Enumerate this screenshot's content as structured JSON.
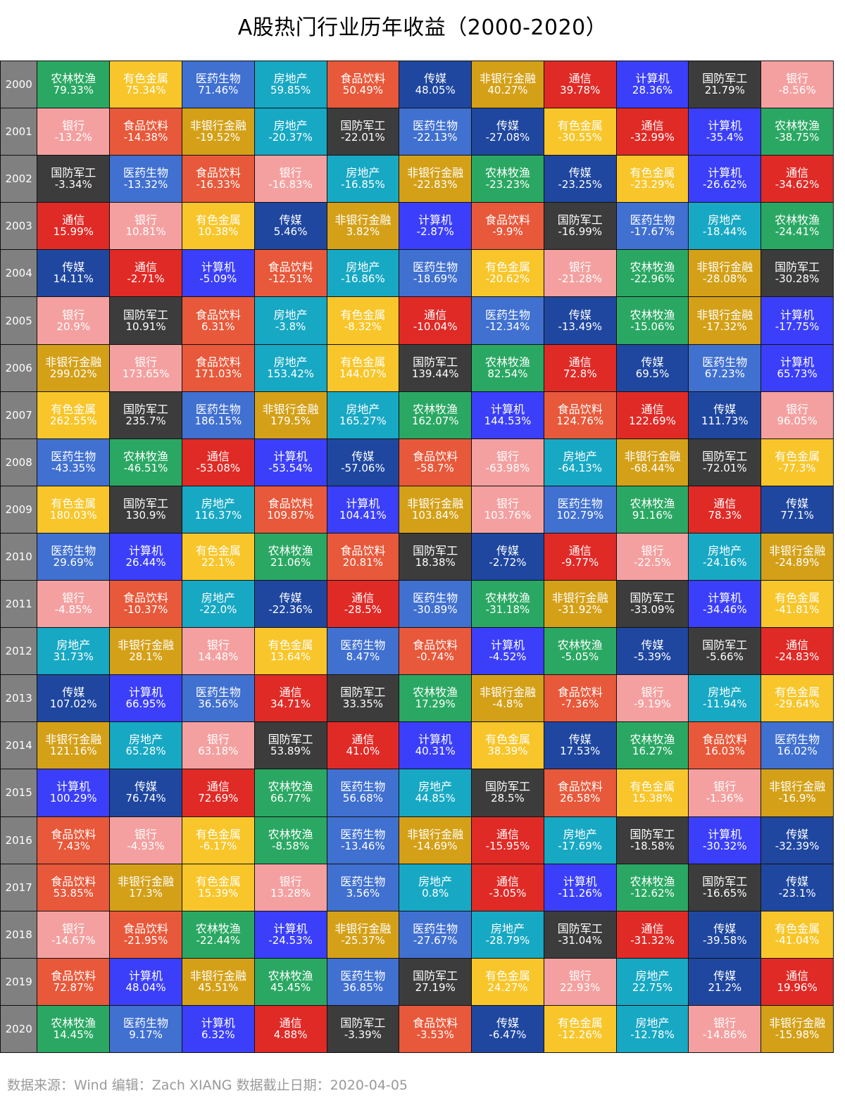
{
  "title": "A股热门行业历年收益（2000-2020）",
  "footer": "数据来源：Wind 编辑：Zach XIANG 数据截止日期：2020-04-05",
  "colors": {
    "农林牧渔": "#2aa863",
    "有色金属": "#f8c62a",
    "医药生物": "#4070d0",
    "房地产": "#17a8c4",
    "食品饮料": "#e8583a",
    "传媒": "#1f47a0",
    "非银行金融": "#d4a017",
    "通信": "#e02a26",
    "计算机": "#3b3ffa",
    "国防军工": "#3c3c3c",
    "银行": "#f4a0a0"
  },
  "chart_data": {
    "type": "table",
    "title": "A股热门行业历年收益（2000-2020）",
    "rows": [
      {
        "year": "2000",
        "cells": [
          [
            "农林牧渔",
            "79.33%"
          ],
          [
            "有色金属",
            "75.34%"
          ],
          [
            "医药生物",
            "71.46%"
          ],
          [
            "房地产",
            "59.85%"
          ],
          [
            "食品饮料",
            "50.49%"
          ],
          [
            "传媒",
            "48.05%"
          ],
          [
            "非银行金融",
            "40.27%"
          ],
          [
            "通信",
            "39.78%"
          ],
          [
            "计算机",
            "28.36%"
          ],
          [
            "国防军工",
            "21.79%"
          ],
          [
            "银行",
            "-8.56%"
          ]
        ]
      },
      {
        "year": "2001",
        "cells": [
          [
            "银行",
            "-13.2%"
          ],
          [
            "食品饮料",
            "-14.38%"
          ],
          [
            "非银行金融",
            "-19.52%"
          ],
          [
            "房地产",
            "-20.37%"
          ],
          [
            "国防军工",
            "-22.01%"
          ],
          [
            "医药生物",
            "-22.13%"
          ],
          [
            "传媒",
            "-27.08%"
          ],
          [
            "有色金属",
            "-30.55%"
          ],
          [
            "通信",
            "-32.99%"
          ],
          [
            "计算机",
            "-35.4%"
          ],
          [
            "农林牧渔",
            "-38.75%"
          ]
        ]
      },
      {
        "year": "2002",
        "cells": [
          [
            "国防军工",
            "-3.34%"
          ],
          [
            "医药生物",
            "-13.32%"
          ],
          [
            "食品饮料",
            "-16.33%"
          ],
          [
            "银行",
            "-16.83%"
          ],
          [
            "房地产",
            "-16.85%"
          ],
          [
            "非银行金融",
            "-22.83%"
          ],
          [
            "农林牧渔",
            "-23.23%"
          ],
          [
            "传媒",
            "-23.25%"
          ],
          [
            "有色金属",
            "-23.29%"
          ],
          [
            "计算机",
            "-26.62%"
          ],
          [
            "通信",
            "-34.62%"
          ]
        ]
      },
      {
        "year": "2003",
        "cells": [
          [
            "通信",
            "15.99%"
          ],
          [
            "银行",
            "10.81%"
          ],
          [
            "有色金属",
            "10.38%"
          ],
          [
            "传媒",
            "5.46%"
          ],
          [
            "非银行金融",
            "3.82%"
          ],
          [
            "计算机",
            "-2.87%"
          ],
          [
            "食品饮料",
            "-9.9%"
          ],
          [
            "国防军工",
            "-16.99%"
          ],
          [
            "医药生物",
            "-17.67%"
          ],
          [
            "房地产",
            "-18.44%"
          ],
          [
            "农林牧渔",
            "-24.41%"
          ]
        ]
      },
      {
        "year": "2004",
        "cells": [
          [
            "传媒",
            "14.11%"
          ],
          [
            "通信",
            "-2.71%"
          ],
          [
            "计算机",
            "-5.09%"
          ],
          [
            "食品饮料",
            "-12.51%"
          ],
          [
            "房地产",
            "-16.86%"
          ],
          [
            "医药生物",
            "-18.69%"
          ],
          [
            "有色金属",
            "-20.62%"
          ],
          [
            "银行",
            "-21.28%"
          ],
          [
            "农林牧渔",
            "-22.96%"
          ],
          [
            "非银行金融",
            "-28.08%"
          ],
          [
            "国防军工",
            "-30.28%"
          ]
        ]
      },
      {
        "year": "2005",
        "cells": [
          [
            "银行",
            "20.9%"
          ],
          [
            "国防军工",
            "10.91%"
          ],
          [
            "食品饮料",
            "6.31%"
          ],
          [
            "房地产",
            "-3.8%"
          ],
          [
            "有色金属",
            "-8.32%"
          ],
          [
            "通信",
            "-10.04%"
          ],
          [
            "医药生物",
            "-12.34%"
          ],
          [
            "传媒",
            "-13.49%"
          ],
          [
            "农林牧渔",
            "-15.06%"
          ],
          [
            "非银行金融",
            "-17.32%"
          ],
          [
            "计算机",
            "-17.75%"
          ]
        ]
      },
      {
        "year": "2006",
        "cells": [
          [
            "非银行金融",
            "299.02%"
          ],
          [
            "银行",
            "173.65%"
          ],
          [
            "食品饮料",
            "171.03%"
          ],
          [
            "房地产",
            "153.42%"
          ],
          [
            "有色金属",
            "144.07%"
          ],
          [
            "国防军工",
            "139.44%"
          ],
          [
            "农林牧渔",
            "82.54%"
          ],
          [
            "通信",
            "72.8%"
          ],
          [
            "传媒",
            "69.5%"
          ],
          [
            "医药生物",
            "67.23%"
          ],
          [
            "计算机",
            "65.73%"
          ]
        ]
      },
      {
        "year": "2007",
        "cells": [
          [
            "有色金属",
            "262.55%"
          ],
          [
            "国防军工",
            "235.7%"
          ],
          [
            "医药生物",
            "186.15%"
          ],
          [
            "非银行金融",
            "179.5%"
          ],
          [
            "房地产",
            "165.27%"
          ],
          [
            "农林牧渔",
            "162.07%"
          ],
          [
            "计算机",
            "144.53%"
          ],
          [
            "食品饮料",
            "124.76%"
          ],
          [
            "通信",
            "122.69%"
          ],
          [
            "传媒",
            "111.73%"
          ],
          [
            "银行",
            "96.05%"
          ]
        ]
      },
      {
        "year": "2008",
        "cells": [
          [
            "医药生物",
            "-43.35%"
          ],
          [
            "农林牧渔",
            "-46.51%"
          ],
          [
            "通信",
            "-53.08%"
          ],
          [
            "计算机",
            "-53.54%"
          ],
          [
            "传媒",
            "-57.06%"
          ],
          [
            "食品饮料",
            "-58.7%"
          ],
          [
            "银行",
            "-63.98%"
          ],
          [
            "房地产",
            "-64.13%"
          ],
          [
            "非银行金融",
            "-68.44%"
          ],
          [
            "国防军工",
            "-72.01%"
          ],
          [
            "有色金属",
            "-77.3%"
          ]
        ]
      },
      {
        "year": "2009",
        "cells": [
          [
            "有色金属",
            "180.03%"
          ],
          [
            "国防军工",
            "130.9%"
          ],
          [
            "房地产",
            "116.37%"
          ],
          [
            "食品饮料",
            "109.87%"
          ],
          [
            "计算机",
            "104.41%"
          ],
          [
            "非银行金融",
            "103.84%"
          ],
          [
            "银行",
            "103.76%"
          ],
          [
            "医药生物",
            "102.79%"
          ],
          [
            "农林牧渔",
            "91.16%"
          ],
          [
            "通信",
            "78.3%"
          ],
          [
            "传媒",
            "77.1%"
          ]
        ]
      },
      {
        "year": "2010",
        "cells": [
          [
            "医药生物",
            "29.69%"
          ],
          [
            "计算机",
            "26.44%"
          ],
          [
            "有色金属",
            "22.1%"
          ],
          [
            "农林牧渔",
            "21.06%"
          ],
          [
            "食品饮料",
            "20.81%"
          ],
          [
            "国防军工",
            "18.38%"
          ],
          [
            "传媒",
            "-2.72%"
          ],
          [
            "通信",
            "-9.77%"
          ],
          [
            "银行",
            "-22.5%"
          ],
          [
            "房地产",
            "-24.16%"
          ],
          [
            "非银行金融",
            "-24.89%"
          ]
        ]
      },
      {
        "year": "2011",
        "cells": [
          [
            "银行",
            "-4.85%"
          ],
          [
            "食品饮料",
            "-10.37%"
          ],
          [
            "房地产",
            "-22.0%"
          ],
          [
            "传媒",
            "-22.36%"
          ],
          [
            "通信",
            "-28.5%"
          ],
          [
            "医药生物",
            "-30.89%"
          ],
          [
            "农林牧渔",
            "-31.18%"
          ],
          [
            "非银行金融",
            "-31.92%"
          ],
          [
            "国防军工",
            "-33.09%"
          ],
          [
            "计算机",
            "-34.46%"
          ],
          [
            "有色金属",
            "-41.81%"
          ]
        ]
      },
      {
        "year": "2012",
        "cells": [
          [
            "房地产",
            "31.73%"
          ],
          [
            "非银行金融",
            "28.1%"
          ],
          [
            "银行",
            "14.48%"
          ],
          [
            "有色金属",
            "13.64%"
          ],
          [
            "医药生物",
            "8.47%"
          ],
          [
            "食品饮料",
            "-0.74%"
          ],
          [
            "计算机",
            "-4.52%"
          ],
          [
            "农林牧渔",
            "-5.05%"
          ],
          [
            "传媒",
            "-5.39%"
          ],
          [
            "国防军工",
            "-5.66%"
          ],
          [
            "通信",
            "-24.83%"
          ]
        ]
      },
      {
        "year": "2013",
        "cells": [
          [
            "传媒",
            "107.02%"
          ],
          [
            "计算机",
            "66.95%"
          ],
          [
            "医药生物",
            "36.56%"
          ],
          [
            "通信",
            "34.71%"
          ],
          [
            "国防军工",
            "33.35%"
          ],
          [
            "农林牧渔",
            "17.29%"
          ],
          [
            "非银行金融",
            "-4.8%"
          ],
          [
            "食品饮料",
            "-7.36%"
          ],
          [
            "银行",
            "-9.19%"
          ],
          [
            "房地产",
            "-11.94%"
          ],
          [
            "有色金属",
            "-29.64%"
          ]
        ]
      },
      {
        "year": "2014",
        "cells": [
          [
            "非银行金融",
            "121.16%"
          ],
          [
            "房地产",
            "65.28%"
          ],
          [
            "银行",
            "63.18%"
          ],
          [
            "国防军工",
            "53.89%"
          ],
          [
            "通信",
            "41.0%"
          ],
          [
            "计算机",
            "40.31%"
          ],
          [
            "有色金属",
            "38.39%"
          ],
          [
            "传媒",
            "17.53%"
          ],
          [
            "农林牧渔",
            "16.27%"
          ],
          [
            "食品饮料",
            "16.03%"
          ],
          [
            "医药生物",
            "16.02%"
          ]
        ]
      },
      {
        "year": "2015",
        "cells": [
          [
            "计算机",
            "100.29%"
          ],
          [
            "传媒",
            "76.74%"
          ],
          [
            "通信",
            "72.69%"
          ],
          [
            "农林牧渔",
            "66.77%"
          ],
          [
            "医药生物",
            "56.68%"
          ],
          [
            "房地产",
            "44.85%"
          ],
          [
            "国防军工",
            "28.5%"
          ],
          [
            "食品饮料",
            "26.58%"
          ],
          [
            "有色金属",
            "15.38%"
          ],
          [
            "银行",
            "-1.36%"
          ],
          [
            "非银行金融",
            "-16.9%"
          ]
        ]
      },
      {
        "year": "2016",
        "cells": [
          [
            "食品饮料",
            "7.43%"
          ],
          [
            "银行",
            "-4.93%"
          ],
          [
            "有色金属",
            "-6.17%"
          ],
          [
            "农林牧渔",
            "-8.58%"
          ],
          [
            "医药生物",
            "-13.46%"
          ],
          [
            "非银行金融",
            "-14.69%"
          ],
          [
            "通信",
            "-15.95%"
          ],
          [
            "房地产",
            "-17.69%"
          ],
          [
            "国防军工",
            "-18.58%"
          ],
          [
            "计算机",
            "-30.32%"
          ],
          [
            "传媒",
            "-32.39%"
          ]
        ]
      },
      {
        "year": "2017",
        "cells": [
          [
            "食品饮料",
            "53.85%"
          ],
          [
            "非银行金融",
            "17.3%"
          ],
          [
            "有色金属",
            "15.39%"
          ],
          [
            "银行",
            "13.28%"
          ],
          [
            "医药生物",
            "3.56%"
          ],
          [
            "房地产",
            "0.8%"
          ],
          [
            "通信",
            "-3.05%"
          ],
          [
            "计算机",
            "-11.26%"
          ],
          [
            "农林牧渔",
            "-12.62%"
          ],
          [
            "国防军工",
            "-16.65%"
          ],
          [
            "传媒",
            "-23.1%"
          ]
        ]
      },
      {
        "year": "2018",
        "cells": [
          [
            "银行",
            "-14.67%"
          ],
          [
            "食品饮料",
            "-21.95%"
          ],
          [
            "农林牧渔",
            "-22.44%"
          ],
          [
            "计算机",
            "-24.53%"
          ],
          [
            "非银行金融",
            "-25.37%"
          ],
          [
            "医药生物",
            "-27.67%"
          ],
          [
            "房地产",
            "-28.79%"
          ],
          [
            "国防军工",
            "-31.04%"
          ],
          [
            "通信",
            "-31.32%"
          ],
          [
            "传媒",
            "-39.58%"
          ],
          [
            "有色金属",
            "-41.04%"
          ]
        ]
      },
      {
        "year": "2019",
        "cells": [
          [
            "食品饮料",
            "72.87%"
          ],
          [
            "计算机",
            "48.04%"
          ],
          [
            "非银行金融",
            "45.51%"
          ],
          [
            "农林牧渔",
            "45.45%"
          ],
          [
            "医药生物",
            "36.85%"
          ],
          [
            "国防军工",
            "27.19%"
          ],
          [
            "有色金属",
            "24.27%"
          ],
          [
            "银行",
            "22.93%"
          ],
          [
            "房地产",
            "22.75%"
          ],
          [
            "传媒",
            "21.2%"
          ],
          [
            "通信",
            "19.96%"
          ]
        ]
      },
      {
        "year": "2020",
        "cells": [
          [
            "农林牧渔",
            "14.45%"
          ],
          [
            "医药生物",
            "9.17%"
          ],
          [
            "计算机",
            "6.32%"
          ],
          [
            "通信",
            "4.88%"
          ],
          [
            "国防军工",
            "-3.39%"
          ],
          [
            "食品饮料",
            "-3.53%"
          ],
          [
            "传媒",
            "-6.47%"
          ],
          [
            "有色金属",
            "-12.26%"
          ],
          [
            "房地产",
            "-12.78%"
          ],
          [
            "银行",
            "-14.86%"
          ],
          [
            "非银行金融",
            "-15.98%"
          ]
        ]
      }
    ]
  }
}
